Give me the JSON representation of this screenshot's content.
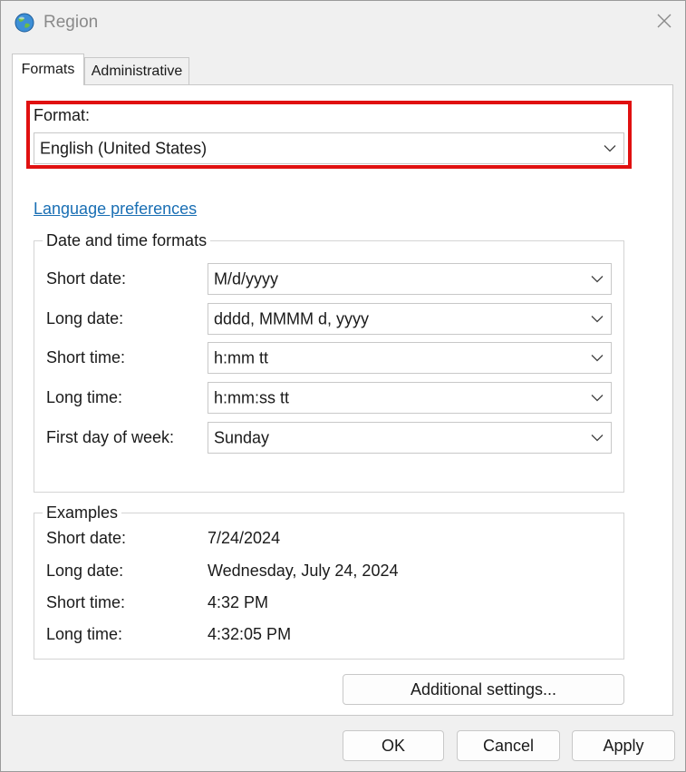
{
  "window": {
    "title": "Region"
  },
  "tabs": [
    {
      "label": "Formats",
      "selected": true
    },
    {
      "label": "Administrative",
      "selected": false
    }
  ],
  "format": {
    "label": "Format:",
    "value": "English (United States)"
  },
  "link": {
    "label": "Language preferences"
  },
  "date_time_formats": {
    "title": "Date and time formats",
    "rows": [
      {
        "label": "Short date:",
        "value": "M/d/yyyy"
      },
      {
        "label": "Long date:",
        "value": "dddd, MMMM d, yyyy"
      },
      {
        "label": "Short time:",
        "value": "h:mm tt"
      },
      {
        "label": "Long time:",
        "value": "h:mm:ss tt"
      },
      {
        "label": "First day of week:",
        "value": "Sunday"
      }
    ]
  },
  "examples": {
    "title": "Examples",
    "rows": [
      {
        "label": "Short date:",
        "value": "7/24/2024"
      },
      {
        "label": "Long date:",
        "value": "Wednesday, July 24, 2024"
      },
      {
        "label": "Short time:",
        "value": "4:32 PM"
      },
      {
        "label": "Long time:",
        "value": "4:32:05 PM"
      }
    ]
  },
  "buttons": {
    "additional": "Additional settings...",
    "ok": "OK",
    "cancel": "Cancel",
    "apply": "Apply"
  },
  "colors": {
    "highlight": "#e01010",
    "link": "#1a6fb4",
    "background": "#f0f0f0",
    "panel": "#ffffff"
  },
  "icons": {
    "app": "globe-icon",
    "close": "close-icon",
    "dropdown": "chevron-down-icon"
  }
}
